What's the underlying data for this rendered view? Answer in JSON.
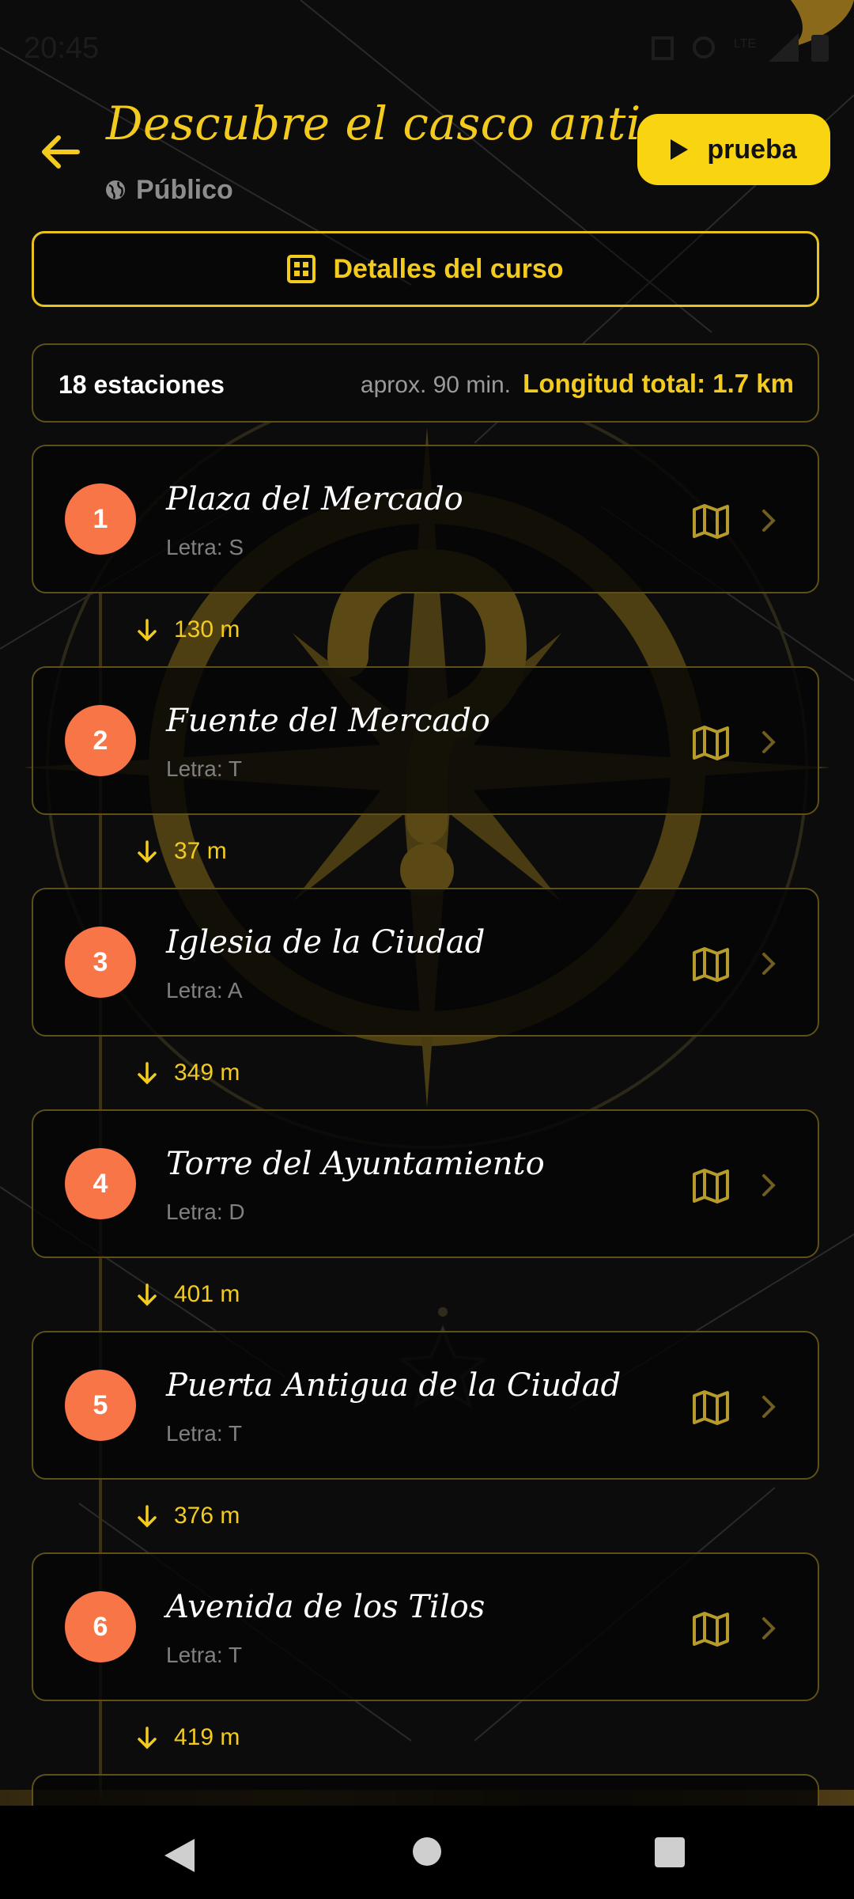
{
  "status_bar": {
    "time": "20:45",
    "network": "LTE"
  },
  "header": {
    "back_icon": "arrow-left-icon",
    "title": "Descubre el casco antiguo",
    "visibility_icon": "globe-icon",
    "visibility": "Público",
    "test_button_icon": "play-icon",
    "test_button": "prueba"
  },
  "details_button": {
    "icon": "grid-icon",
    "label": "Detalles del curso"
  },
  "summary": {
    "stations": "18 estaciones",
    "duration": "aprox. 90 min.",
    "length": "Longitud total: 1.7 km"
  },
  "stations": [
    {
      "number": "1",
      "name": "Plaza del Mercado",
      "letter": "Letra: S",
      "distance_next": "130 m"
    },
    {
      "number": "2",
      "name": "Fuente del Mercado",
      "letter": "Letra: T",
      "distance_next": "37 m"
    },
    {
      "number": "3",
      "name": "Iglesia de la Ciudad",
      "letter": "Letra: A",
      "distance_next": "349 m"
    },
    {
      "number": "4",
      "name": "Torre del Ayuntamiento",
      "letter": "Letra: D",
      "distance_next": "401 m"
    },
    {
      "number": "5",
      "name": "Puerta Antigua de la Ciudad",
      "letter": "Letra: T",
      "distance_next": "376 m"
    },
    {
      "number": "6",
      "name": "Avenida de los Tilos",
      "letter": "Letra: T",
      "distance_next": "419 m"
    }
  ],
  "colors": {
    "accent": "#f3cb1f",
    "station_badge": "#f87548",
    "background": "#0c0c0c"
  }
}
